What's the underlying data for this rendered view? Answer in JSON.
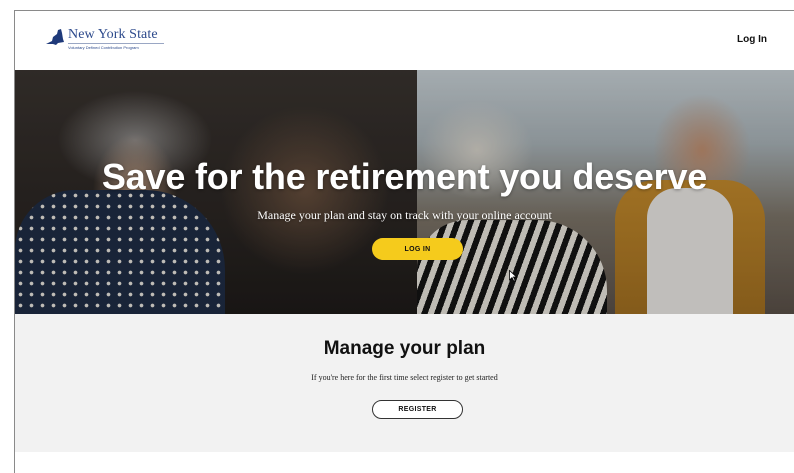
{
  "header": {
    "logo_title": "New York State",
    "logo_subtitle": "Voluntary Defined Contribution Program",
    "login_link": "Log In"
  },
  "hero": {
    "title": "Save for the retirement you deserve",
    "subtitle": "Manage your plan and stay on track with your online account",
    "login_button": "LOG IN"
  },
  "manage": {
    "title": "Manage your plan",
    "subtitle": "If you're here for the first time select register to get started",
    "register_button": "REGISTER"
  },
  "colors": {
    "accent_yellow": "#f5cb1c",
    "brand_blue": "#2d4a8c",
    "section_bg": "#f2f2f2"
  },
  "icons": {
    "logo": "new-york-state-map-icon",
    "cursor": "mouse-pointer-icon"
  }
}
